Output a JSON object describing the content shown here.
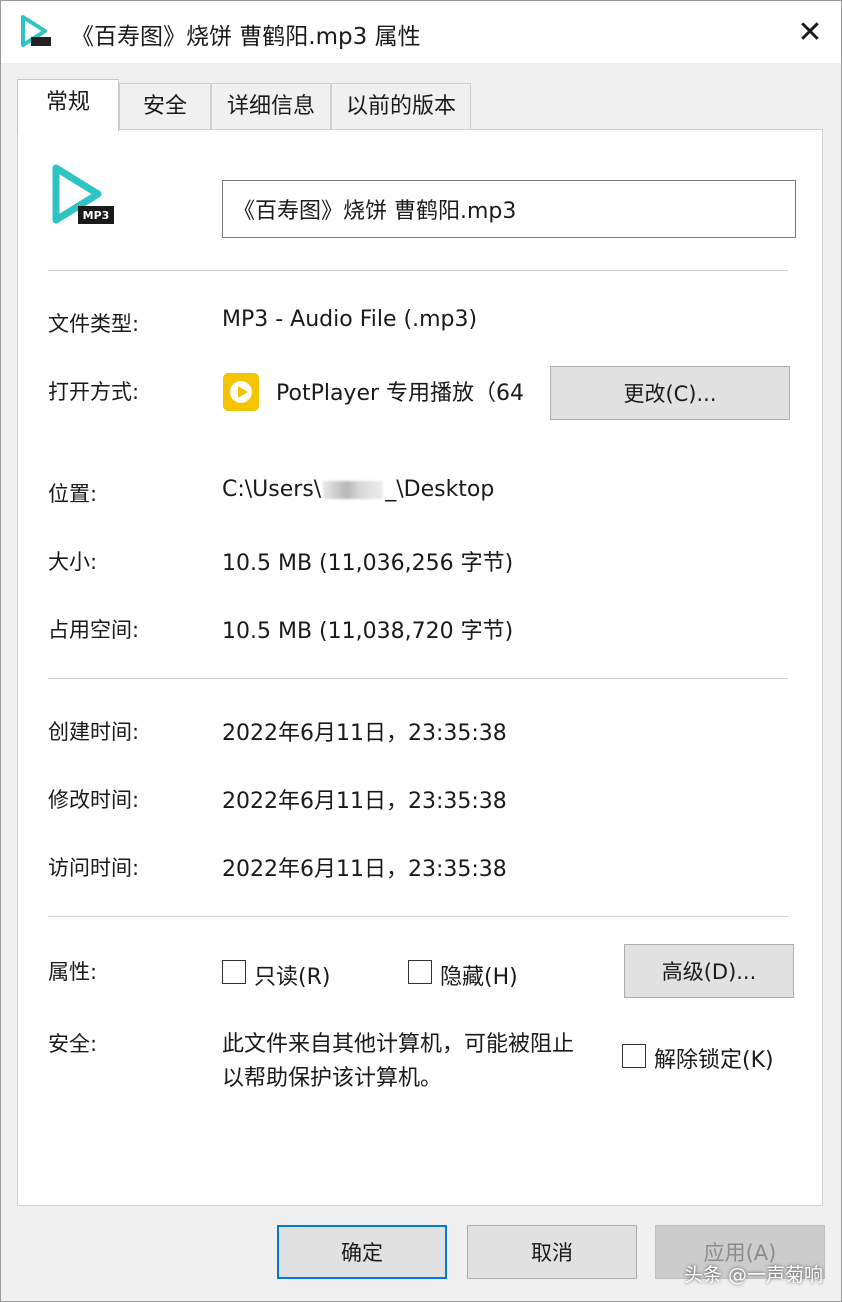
{
  "window": {
    "title": "《百寿图》烧饼 曹鹤阳.mp3 属性",
    "close": "✕"
  },
  "tabs": [
    {
      "label": "常规",
      "active": true
    },
    {
      "label": "安全"
    },
    {
      "label": "详细信息"
    },
    {
      "label": "以前的版本"
    }
  ],
  "file": {
    "name": "《百寿图》烧饼 曹鹤阳.mp3",
    "icon": "mp3-file-icon"
  },
  "general": {
    "type_label": "文件类型:",
    "type_value": "MP3 - Audio File (.mp3)",
    "opens_label": "打开方式:",
    "opens_value": "PotPlayer 专用播放（64",
    "change_button": "更改(C)...",
    "location_label": "位置:",
    "location_prefix": "C:\\Users\\",
    "location_suffix": "_\\Desktop",
    "size_label": "大小:",
    "size_value": "10.5 MB (11,036,256 字节)",
    "disk_label": "占用空间:",
    "disk_value": "10.5 MB (11,038,720 字节)"
  },
  "times": {
    "created_label": "创建时间:",
    "created_value": "2022年6月11日，23:35:38",
    "modified_label": "修改时间:",
    "modified_value": "2022年6月11日，23:35:38",
    "accessed_label": "访问时间:",
    "accessed_value": "2022年6月11日，23:35:38"
  },
  "attributes": {
    "label": "属性:",
    "readonly": "只读(R)",
    "hidden": "隐藏(H)",
    "advanced_button": "高级(D)...",
    "security_label": "安全:",
    "security_line1": "此文件来自其他计算机，可能被阻止",
    "security_line2": "以帮助保护该计算机。",
    "unblock": "解除锁定(K)"
  },
  "footer": {
    "ok": "确定",
    "cancel": "取消",
    "apply": "应用(A)"
  },
  "watermark": "头条 @一声菊响",
  "colors": {
    "accent": "#0078d7",
    "player_icon": "#f5c400",
    "mp3_icon": "#2ec4c4"
  }
}
